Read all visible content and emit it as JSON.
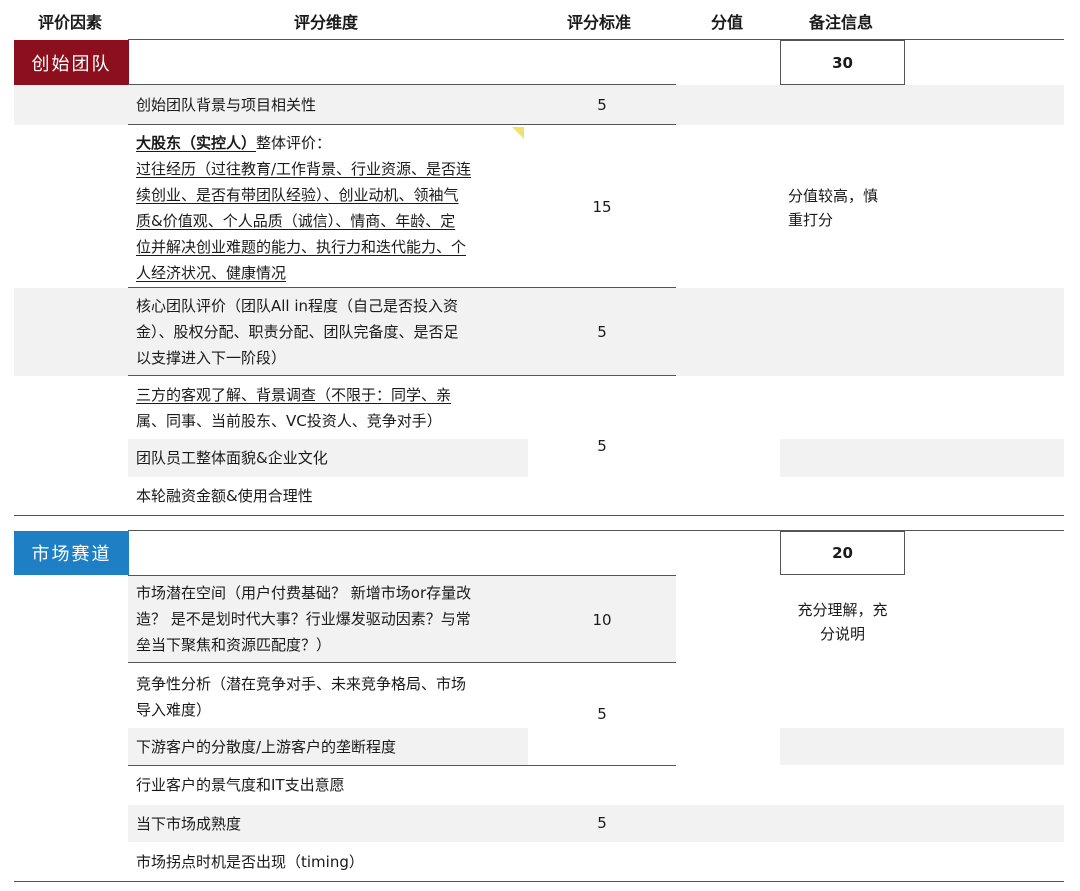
{
  "colors": {
    "team_accent": "#8b0f1c",
    "market_accent": "#1f7fc4",
    "row_gray": "#f2f2f2"
  },
  "header": {
    "factor": "评价因素",
    "dimension": "评分维度",
    "standard": "评分标准",
    "score": "分值",
    "notes": "备注信息"
  },
  "team": {
    "label": "创始团队",
    "score": "30",
    "rows": [
      {
        "dimension": "创始团队背景与项目相关性",
        "standard": "5"
      },
      {
        "dimension_lead": "大股东（实控人）",
        "dimension_lead_suffix": "整体评价：",
        "dimension_lines": [
          "过往经历（过往教育/工作背景、行业资源、是否连",
          "续创业、是否有带团队经验）、创业动机、领袖气",
          "质&价值观、个人品质（诚信）、情商、年龄、定",
          "位并解决创业难题的能力、执行力和迭代能力、个",
          "人经济状况、健康情况"
        ],
        "standard": "15",
        "note_lines": [
          "分值较高，慎",
          "重打分"
        ]
      },
      {
        "dimension_lines": [
          "核心团队评价（团队All  in程度（自己是否投入资",
          "金）、股权分配、职责分配、团队完备度、是否足",
          "以支撑进入下一阶段）"
        ],
        "standard": "5"
      },
      {
        "dimension_lines": [
          "三方的客观了解、背景调查（不限于：同学、亲",
          "属、同事、当前股东、VC投资人、竞争对手）"
        ]
      },
      {
        "dimension": "团队员工整体面貌&企业文化"
      },
      {
        "dimension": "本轮融资金额&使用合理性"
      }
    ],
    "group_standard": "5"
  },
  "market": {
    "label": "市场赛道",
    "score": "20",
    "rows": [
      {
        "dimension_lines": [
          "市场潜在空间（用户付费基础？ 新增市场or存量改",
          "造？ 是不是划时代大事？行业爆发驱动因素？与常",
          "垒当下聚焦和资源匹配度？）"
        ],
        "standard": "10",
        "note_lines": [
          "充分理解，充",
          "分说明"
        ]
      },
      {
        "dimension_lines": [
          "竞争性分析（潜在竞争对手、未来竞争格局、市场",
          "导入难度）"
        ]
      },
      {
        "dimension": "下游客户的分散度/上游客户的垄断程度"
      },
      {
        "dimension": "行业客户的景气度和IT支出意愿"
      },
      {
        "dimension": "当下市场成熟度"
      },
      {
        "dimension": "市场拐点时机是否出现（timing）"
      }
    ],
    "group_standard_a": "5",
    "group_standard_b": "5"
  }
}
